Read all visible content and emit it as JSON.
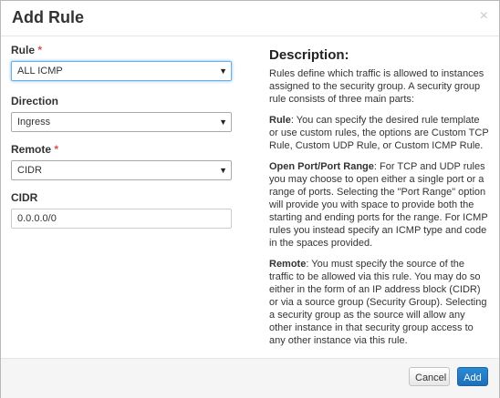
{
  "dialog": {
    "title": "Add Rule",
    "close_glyph": "×"
  },
  "form": {
    "rule": {
      "label": "Rule",
      "required_mark": "*",
      "selected": "ALL ICMP"
    },
    "direction": {
      "label": "Direction",
      "selected": "Ingress"
    },
    "remote": {
      "label": "Remote",
      "required_mark": "*",
      "selected": "CIDR"
    },
    "cidr": {
      "label": "CIDR",
      "value": "0.0.0.0/0"
    }
  },
  "description": {
    "title": "Description:",
    "intro": "Rules define which traffic is allowed to instances assigned to the security group. A security group rule consists of three main parts:",
    "rule_heading": "Rule",
    "rule_text": ": You can specify the desired rule template or use custom rules, the options are Custom TCP Rule, Custom UDP Rule, or Custom ICMP Rule.",
    "port_heading": "Open Port/Port Range",
    "port_text": ": For TCP and UDP rules you may choose to open either a single port or a range of ports. Selecting the \"Port Range\" option will provide you with space to provide both the starting and ending ports for the range. For ICMP rules you instead specify an ICMP type and code in the spaces provided.",
    "remote_heading": "Remote",
    "remote_text": ": You must specify the source of the traffic to be allowed via this rule. You may do so either in the form of an IP address block (CIDR) or via a source group (Security Group). Selecting a security group as the source will allow any other instance in that security group access to any other instance via this rule."
  },
  "footer": {
    "cancel_label": "Cancel",
    "add_label": "Add"
  },
  "icons": {
    "select_arrow": "▼"
  },
  "colors": {
    "primary": "#1d6fb8",
    "required": "#d9534f",
    "focus": "#66afe9"
  }
}
